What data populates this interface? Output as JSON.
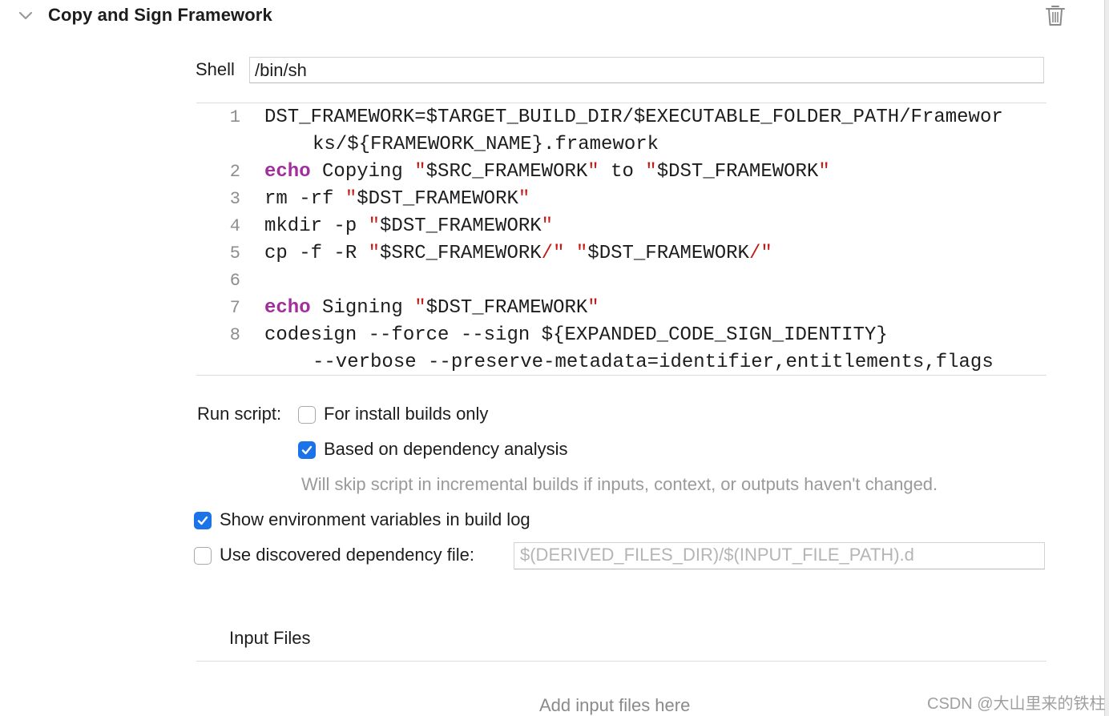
{
  "phase": {
    "title": "Copy and Sign Framework",
    "shell_label": "Shell",
    "shell_value": "/bin/sh"
  },
  "script": {
    "lines": [
      {
        "num": "1",
        "tokens": [
          {
            "t": "DST_FRAMEWORK=$TARGET_BUILD_DIR/$EXECUTABLE_FOLDER_PATH/Framewor",
            "k": "plain"
          }
        ]
      },
      {
        "num": "",
        "cont": true,
        "tokens": [
          {
            "t": "ks/${FRAMEWORK_NAME}.framework",
            "k": "plain"
          }
        ]
      },
      {
        "num": "2",
        "tokens": [
          {
            "t": "echo",
            "k": "kw"
          },
          {
            "t": " Copying ",
            "k": "plain"
          },
          {
            "t": "\"",
            "k": "q"
          },
          {
            "t": "$SRC_FRAMEWORK",
            "k": "plain"
          },
          {
            "t": "\"",
            "k": "q"
          },
          {
            "t": " to ",
            "k": "plain"
          },
          {
            "t": "\"",
            "k": "q"
          },
          {
            "t": "$DST_FRAMEWORK",
            "k": "plain"
          },
          {
            "t": "\"",
            "k": "q"
          }
        ]
      },
      {
        "num": "3",
        "tokens": [
          {
            "t": "rm -rf ",
            "k": "plain"
          },
          {
            "t": "\"",
            "k": "q"
          },
          {
            "t": "$DST_FRAMEWORK",
            "k": "plain"
          },
          {
            "t": "\"",
            "k": "q"
          }
        ]
      },
      {
        "num": "4",
        "tokens": [
          {
            "t": "mkdir -p ",
            "k": "plain"
          },
          {
            "t": "\"",
            "k": "q"
          },
          {
            "t": "$DST_FRAMEWORK",
            "k": "plain"
          },
          {
            "t": "\"",
            "k": "q"
          }
        ]
      },
      {
        "num": "5",
        "tokens": [
          {
            "t": "cp -f -R ",
            "k": "plain"
          },
          {
            "t": "\"",
            "k": "q"
          },
          {
            "t": "$SRC_FRAMEWORK",
            "k": "plain"
          },
          {
            "t": "/\"",
            "k": "q"
          },
          {
            "t": " ",
            "k": "plain"
          },
          {
            "t": "\"",
            "k": "q"
          },
          {
            "t": "$DST_FRAMEWORK",
            "k": "plain"
          },
          {
            "t": "/\"",
            "k": "q"
          }
        ]
      },
      {
        "num": "6",
        "tokens": []
      },
      {
        "num": "7",
        "tokens": [
          {
            "t": "echo",
            "k": "kw"
          },
          {
            "t": " Signing ",
            "k": "plain"
          },
          {
            "t": "\"",
            "k": "q"
          },
          {
            "t": "$DST_FRAMEWORK",
            "k": "plain"
          },
          {
            "t": "\"",
            "k": "q"
          }
        ]
      },
      {
        "num": "8",
        "tokens": [
          {
            "t": "codesign --force --sign ${EXPANDED_CODE_SIGN_IDENTITY}",
            "k": "plain"
          }
        ]
      },
      {
        "num": "",
        "cont": true,
        "tokens": [
          {
            "t": "--verbose --preserve-metadata=identifier,entitlements,flags",
            "k": "plain"
          }
        ]
      }
    ]
  },
  "options": {
    "run_script_label": "Run script:",
    "install_builds_only": {
      "label": "For install builds only",
      "checked": false
    },
    "dependency_analysis": {
      "label": "Based on dependency analysis",
      "checked": true
    },
    "dependency_hint": "Will skip script in incremental builds if inputs, context, or outputs haven't changed.",
    "show_env_vars": {
      "label": "Show environment variables in build log",
      "checked": true
    },
    "use_dep_file": {
      "label": "Use discovered dependency file:",
      "checked": false
    },
    "dep_file_placeholder": "$(DERIVED_FILES_DIR)/$(INPUT_FILE_PATH).d"
  },
  "input_files": {
    "title": "Input Files",
    "empty_message": "Add input files here"
  },
  "watermark": "CSDN @大山里来的铁柱",
  "colors": {
    "accent": "#1a73e8",
    "keyword": "#a12e9c",
    "string": "#c41a16"
  }
}
